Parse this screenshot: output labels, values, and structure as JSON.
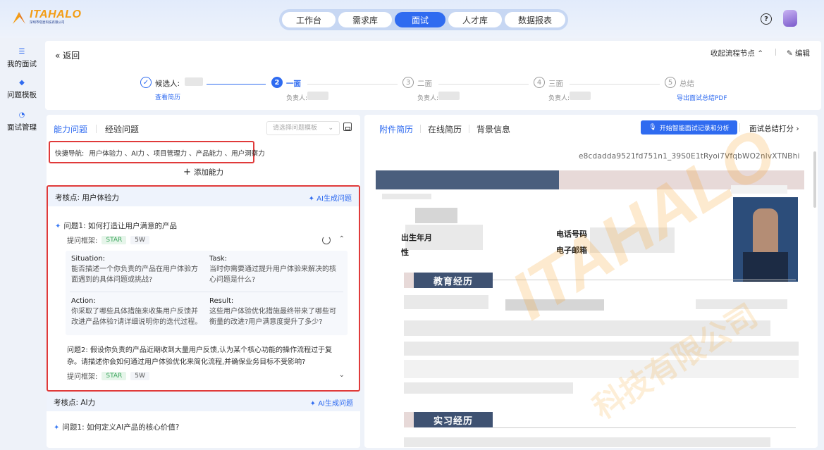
{
  "brand": {
    "name": "ITAHALO",
    "sub": "深圳市塔星科技有限公司"
  },
  "nav": {
    "tabs": [
      {
        "label": "工作台"
      },
      {
        "label": "需求库"
      },
      {
        "label": "面试"
      },
      {
        "label": "人才库"
      },
      {
        "label": "数据报表"
      }
    ],
    "active": "面试",
    "help": "?"
  },
  "sidebar": {
    "items": [
      {
        "label": "我的面试",
        "icon": "list-icon"
      },
      {
        "label": "问题模板",
        "icon": "layers-icon"
      },
      {
        "label": "面试管理",
        "icon": "clock-icon"
      }
    ]
  },
  "header": {
    "back": "« 返回",
    "collapse": "收起流程节点 ⌃",
    "edit": "✎ 编辑",
    "steps": [
      {
        "num": "✓",
        "title": "候选人:",
        "sub": "查看简历"
      },
      {
        "num": "2",
        "title": "一面",
        "sub": "负责人:"
      },
      {
        "num": "3",
        "title": "二面",
        "sub": "负责人:"
      },
      {
        "num": "4",
        "title": "三面",
        "sub": "负责人:"
      },
      {
        "num": "5",
        "title": "总结",
        "sub": "导出面试总结PDF"
      }
    ]
  },
  "left": {
    "tabs": [
      "能力问题",
      "经验问题"
    ],
    "template_placeholder": "请选择问题模板",
    "quick_nav_label": "快捷导航:",
    "quick_nav_items": "用户体验力 、AI力 、项目管理力 、产品能力 、用户洞察力",
    "add_ability": "添加能力",
    "section1": {
      "title": "考核点:  用户体验力",
      "ai_generate": "AI生成问题",
      "q1": "问题1:  如何打造让用户满意的产品",
      "frame_label": "提问框架:",
      "frame_star": "STAR",
      "frame_5w": "5W",
      "star": {
        "s_title": "Situation:",
        "s_body": "能否描述一个你负责的产品在用户体验方面遇到的具体问题或挑战?",
        "t_title": "Task:",
        "t_body": "当时你需要通过提升用户体验来解决的核心问题是什么?",
        "a_title": "Action:",
        "a_body": "你采取了哪些具体措施来收集用户反馈并改进产品体验?请详细说明你的迭代过程。",
        "r_title": "Result:",
        "r_body": "这些用户体验优化措施最终带来了哪些可衡量的改进?用户满意度提升了多少?"
      },
      "q2": "问题2:  假设你负责的产品近期收到大量用户反馈,认为某个核心功能的操作流程过于复杂。请描述你会如何通过用户体验优化来简化流程,并确保业务目标不受影响?"
    },
    "section2": {
      "title": "考核点:  AI力",
      "ai_generate": "AI生成问题",
      "q1": "问题1:  如何定义AI产品的核心价值?"
    }
  },
  "right": {
    "tabs": [
      "附件简历",
      "在线简历",
      "背景信息"
    ],
    "ai_record": "开始智能面试记录和分析",
    "score": "面试总结打分 ›",
    "resume_id": "e8cdadda9521fd751n1_39S0E1tRyoi7VfqbWO2nlvXTNBhi",
    "fields": {
      "birth": "出生年月",
      "gender": "性",
      "phone": "电话号码",
      "email": "电子邮箱"
    },
    "sections": {
      "education": "教育经历",
      "internship": "实习经历"
    },
    "watermark": "ITAHALO",
    "watermark_sub": "科技有限公司"
  }
}
